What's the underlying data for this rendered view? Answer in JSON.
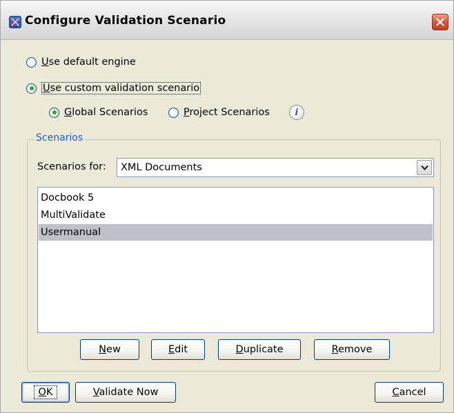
{
  "window": {
    "title": "Configure Validation Scenario",
    "colors": {
      "titlebar": "#e3e3e3",
      "dialog_bg": "#ece9d8",
      "accent_legend": "#1c5ec9",
      "close_red": "#d9573a",
      "selection": "#c0c0c8"
    }
  },
  "engine_options": [
    {
      "mnemonic": "U",
      "rest": "se default engine",
      "checked": false
    },
    {
      "mnemonic": "U",
      "rest": "se custom validation scenario",
      "checked": true
    }
  ],
  "scope_options": [
    {
      "mnemonic": "G",
      "rest": "lobal Scenarios",
      "checked": true
    },
    {
      "mnemonic": "P",
      "rest": "roject Scenarios",
      "checked": false
    }
  ],
  "info_icon": "i",
  "scenarios": {
    "group_label": "Scenarios",
    "for_label": "Scenarios for:",
    "for_value": "XML Documents",
    "items": [
      {
        "label": "Docbook 5",
        "selected": false
      },
      {
        "label": "MultiValidate",
        "selected": false
      },
      {
        "label": "Usermanual",
        "selected": true
      }
    ],
    "buttons": [
      {
        "mnemonic": "N",
        "rest": "ew"
      },
      {
        "mnemonic": "E",
        "rest": "dit"
      },
      {
        "mnemonic": "D",
        "rest": "uplicate"
      },
      {
        "mnemonic": "R",
        "rest": "emove"
      }
    ]
  },
  "footer": {
    "ok": {
      "mnemonic": "O",
      "rest": "K"
    },
    "validate_now": {
      "mnemonic": "V",
      "rest": "alidate Now"
    },
    "cancel": {
      "mnemonic": "C",
      "rest": "ancel"
    }
  }
}
